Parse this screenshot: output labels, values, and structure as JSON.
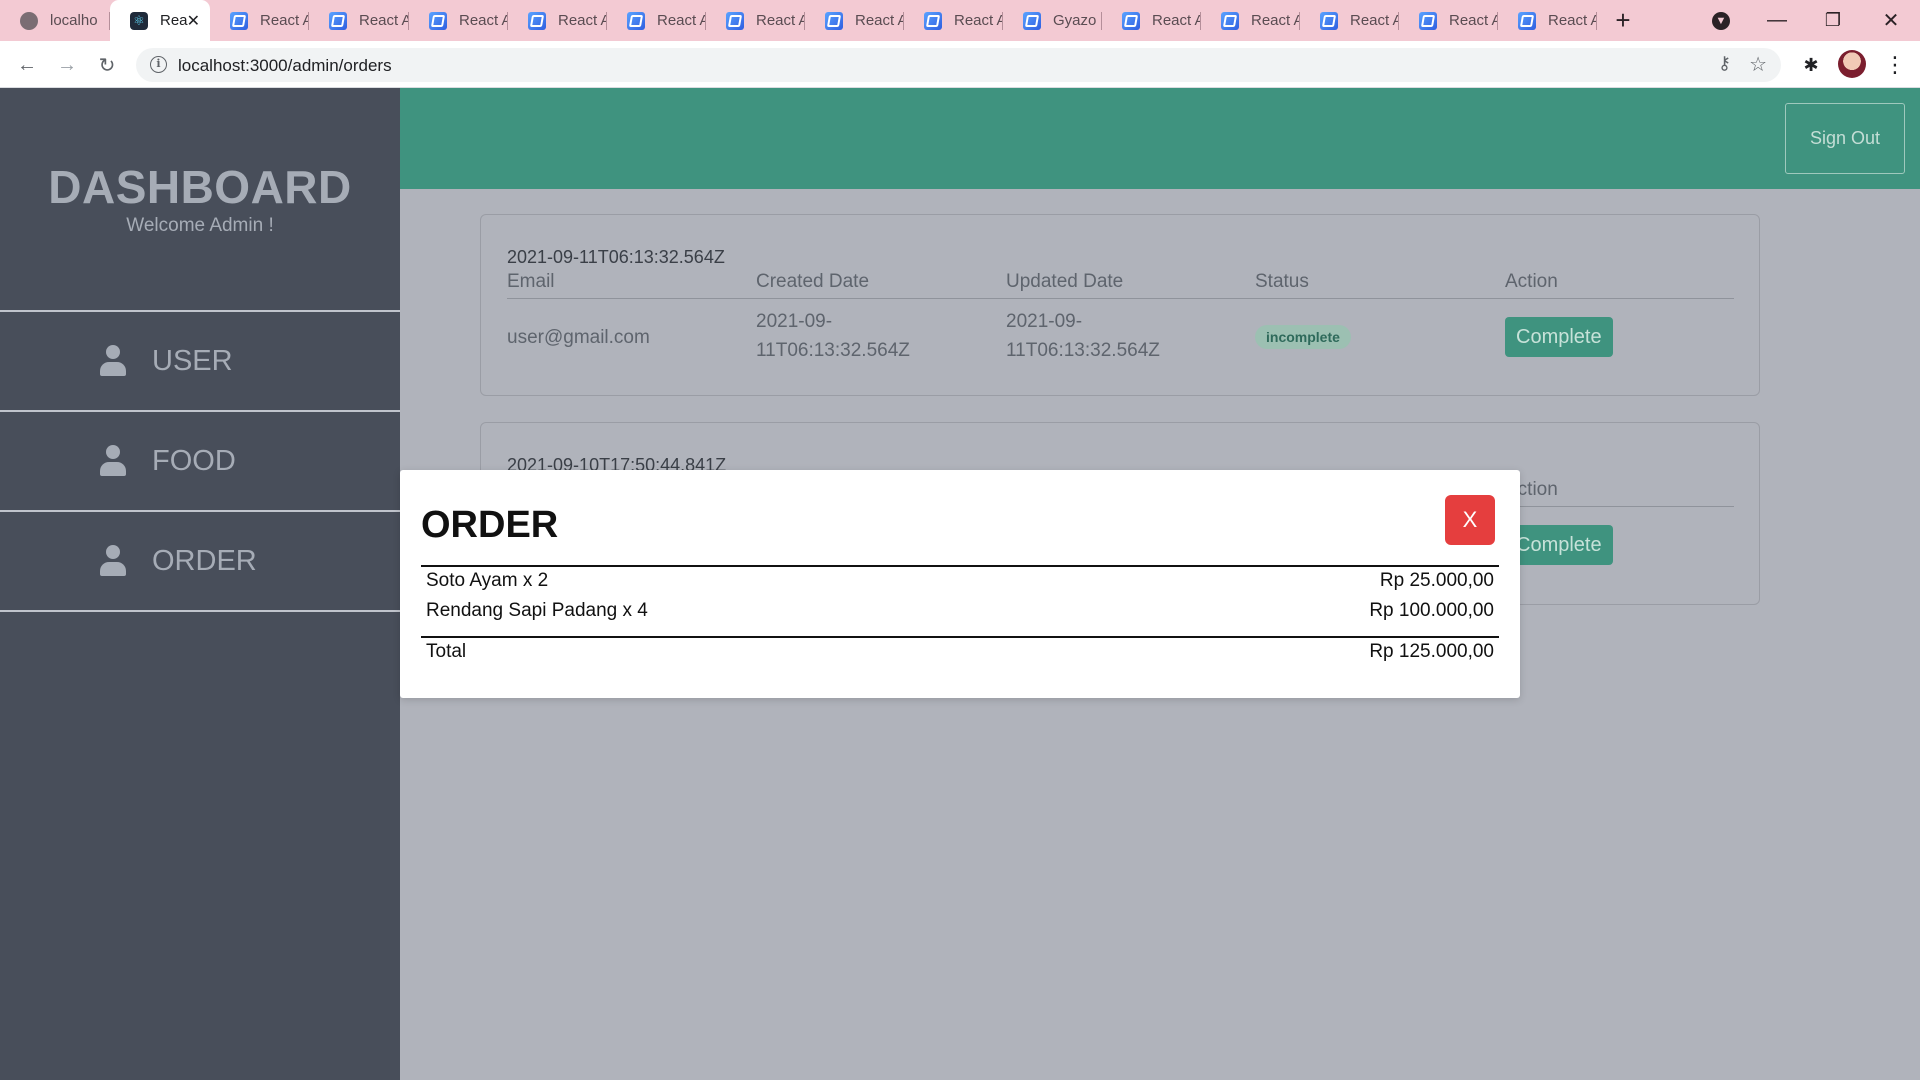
{
  "browser": {
    "tabs": [
      {
        "label": "localho",
        "icon": "globe-icon"
      },
      {
        "label": "Rea",
        "icon": "react-logo-icon",
        "active": true
      },
      {
        "label": "React A",
        "icon": "react-app-icon"
      },
      {
        "label": "React A",
        "icon": "react-app-icon"
      },
      {
        "label": "React A",
        "icon": "react-app-icon"
      },
      {
        "label": "React A",
        "icon": "react-app-icon"
      },
      {
        "label": "React A",
        "icon": "react-app-icon"
      },
      {
        "label": "React A",
        "icon": "react-app-icon"
      },
      {
        "label": "React A",
        "icon": "react-app-icon"
      },
      {
        "label": "React A",
        "icon": "react-app-icon"
      },
      {
        "label": "Gyazo",
        "icon": "gyazo-icon"
      },
      {
        "label": "React A",
        "icon": "react-app-icon"
      },
      {
        "label": "React A",
        "icon": "react-app-icon"
      },
      {
        "label": "React A",
        "icon": "react-app-icon"
      },
      {
        "label": "React A",
        "icon": "react-app-icon"
      },
      {
        "label": "React A",
        "icon": "react-app-icon"
      }
    ],
    "url": "localhost:3000/admin/orders",
    "colors": {
      "tabstrip": "#f3cad3",
      "active_tab": "#ffffff"
    }
  },
  "sidebar": {
    "brand": "DASHBOARD",
    "welcome": "Welcome Admin !",
    "items": [
      {
        "label": "USER",
        "icon": "user-icon"
      },
      {
        "label": "FOOD",
        "icon": "user-icon"
      },
      {
        "label": "ORDER",
        "icon": "user-icon"
      }
    ]
  },
  "header": {
    "signout_label": "Sign Out"
  },
  "orders": {
    "columns": [
      "Email",
      "Created Date",
      "Updated Date",
      "Status",
      "Action"
    ],
    "items": [
      {
        "id": "2021-09-11T06:13:32.564Z",
        "email": "user@gmail.com",
        "created_line1": "2021-09-",
        "created_line2": "11T06:13:32.564Z",
        "updated_line1": "2021-09-",
        "updated_line2": "11T06:13:32.564Z",
        "status": "incomplete",
        "action_label": "Complete"
      },
      {
        "id": "2021-09-10T17:50:44.841Z",
        "action_header": "Action",
        "action_label": "Complete"
      }
    ]
  },
  "modal": {
    "title": "ORDER",
    "close_label": "X",
    "items": [
      {
        "name": "Soto Ayam x 2",
        "price": "Rp 25.000,00"
      },
      {
        "name": "Rendang Sapi Padang x 4",
        "price": "Rp 100.000,00"
      }
    ],
    "total_label": "Total",
    "total_value": "Rp 125.000,00"
  },
  "colors": {
    "sidebar": "#484e5a",
    "topbar": "#3f937f",
    "accent_green": "#3f937f",
    "close_red": "#e53e3e",
    "backdrop": "#b0b3bb"
  }
}
